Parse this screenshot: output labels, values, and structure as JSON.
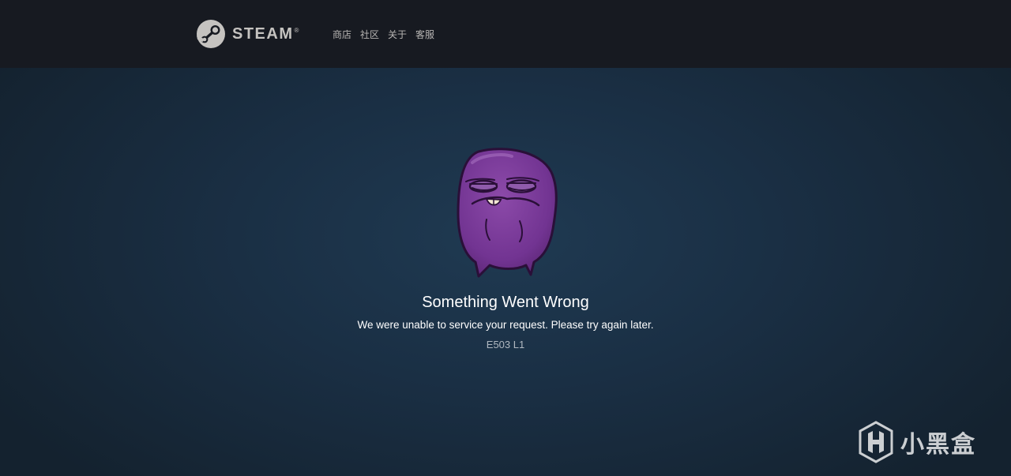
{
  "header": {
    "logo_text": "STEAM",
    "logo_reg": "®",
    "nav": [
      {
        "label": "商店"
      },
      {
        "label": "社区"
      },
      {
        "label": "关于"
      },
      {
        "label": "客服"
      }
    ]
  },
  "error": {
    "title": "Something Went Wrong",
    "message": "We were unable to service your request. Please try again later.",
    "code": "E503 L1",
    "mascot_icon": "purple-blob-mascot",
    "mascot_color": "#7a3b97"
  },
  "watermark": {
    "text": "小黑盒",
    "icon": "xiaoheihe-logo-icon"
  },
  "colors": {
    "header_bg": "#171a21",
    "page_bg": "#1b2838",
    "nav_text": "#b8b6b4"
  }
}
